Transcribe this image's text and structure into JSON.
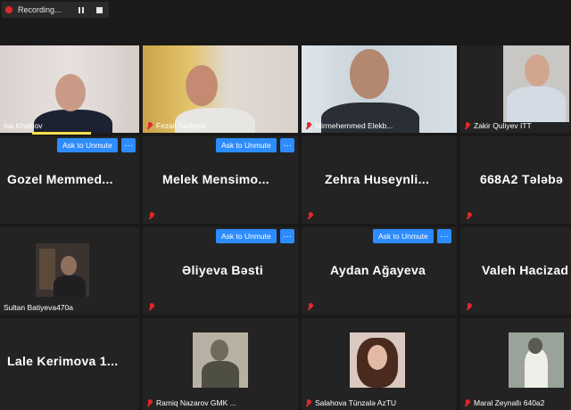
{
  "recording": {
    "label": "Recording...",
    "pause_icon": "pause-icon",
    "stop_icon": "stop-icon"
  },
  "unmute_button_label": "Ask to Unmute",
  "more_button_label": "···",
  "participants": [
    {
      "name": "Isa Khalilov",
      "video": true
    },
    {
      "name": "Fezail Sadiqov",
      "video": true
    },
    {
      "name": "Mirmehemmed Elekb...",
      "video": true
    },
    {
      "name": "Zakir Quliyev ITT",
      "video": true
    },
    {
      "name": "Gozel  Memmed...",
      "video": false
    },
    {
      "name": "Melek  Mensimo...",
      "video": false
    },
    {
      "name": "Zehra  Huseynli...",
      "video": false
    },
    {
      "name": "668A2  Tələbə",
      "video": false
    },
    {
      "name": "Sultan Batiyeva470a",
      "video": true
    },
    {
      "name": "Əliyeva  Bəsti",
      "video": false
    },
    {
      "name": "Aydan  Ağayeva",
      "video": false
    },
    {
      "name": "Valeh  Hacizad",
      "video": false
    },
    {
      "name": "Lale  Kerimova  1...",
      "video": false
    },
    {
      "name": "Ramiq Nazarov  GMK ...",
      "video": true
    },
    {
      "name": "Salahova Tünzalə AzTU",
      "video": true
    },
    {
      "name": "Maral Zeynallı 640a2",
      "video": true
    }
  ],
  "colors": {
    "accent": "#2d8cff",
    "muted_mic": "#e02828",
    "speaking_highlight": "#f5e24a",
    "tile_bg": "#232323"
  }
}
